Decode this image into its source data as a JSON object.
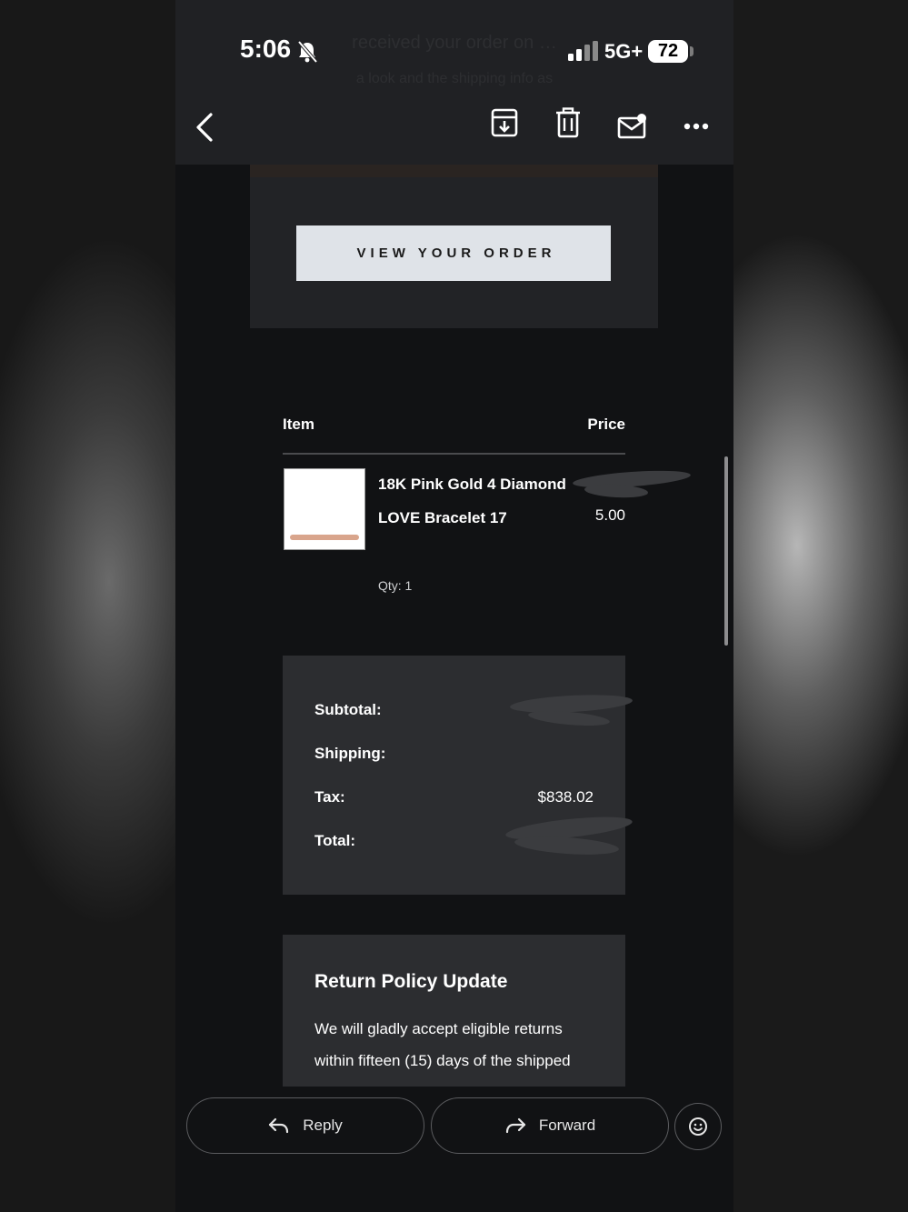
{
  "status_bar": {
    "time": "5:06",
    "network": "5G+",
    "battery": "72"
  },
  "ghost_header": {
    "line1": "received your order on …",
    "line2": "a look and the shipping info as"
  },
  "toolbar": {
    "back_icon": "chevron-left-icon",
    "archive_icon": "archive-icon",
    "delete_icon": "trash-icon",
    "mark_unread_icon": "mail-unread-icon",
    "more_icon": "more-horizontal-icon"
  },
  "email": {
    "view_order_button": "VIEW YOUR ORDER",
    "table": {
      "item_header": "Item",
      "price_header": "Price"
    },
    "item": {
      "name": "18K Pink Gold 4 Diamond LOVE Bracelet 17",
      "qty": "Qty: 1",
      "price_visible": "5.00"
    },
    "totals": {
      "subtotal_label": "Subtotal:",
      "shipping_label": "Shipping:",
      "tax_label": "Tax:",
      "tax_value": "$838.02",
      "total_label": "Total:"
    },
    "policy": {
      "title": "Return Policy Update",
      "text": "We will gladly accept eligible returns within fifteen (15) days of the shipped"
    }
  },
  "actions": {
    "reply": "Reply",
    "forward": "Forward",
    "emoji_icon": "emoji-reaction-icon"
  },
  "colors": {
    "topbar": "#202124",
    "content_bg": "#111214",
    "card_bg": "#2c2d30",
    "button_bg": "#dfe3e8"
  }
}
